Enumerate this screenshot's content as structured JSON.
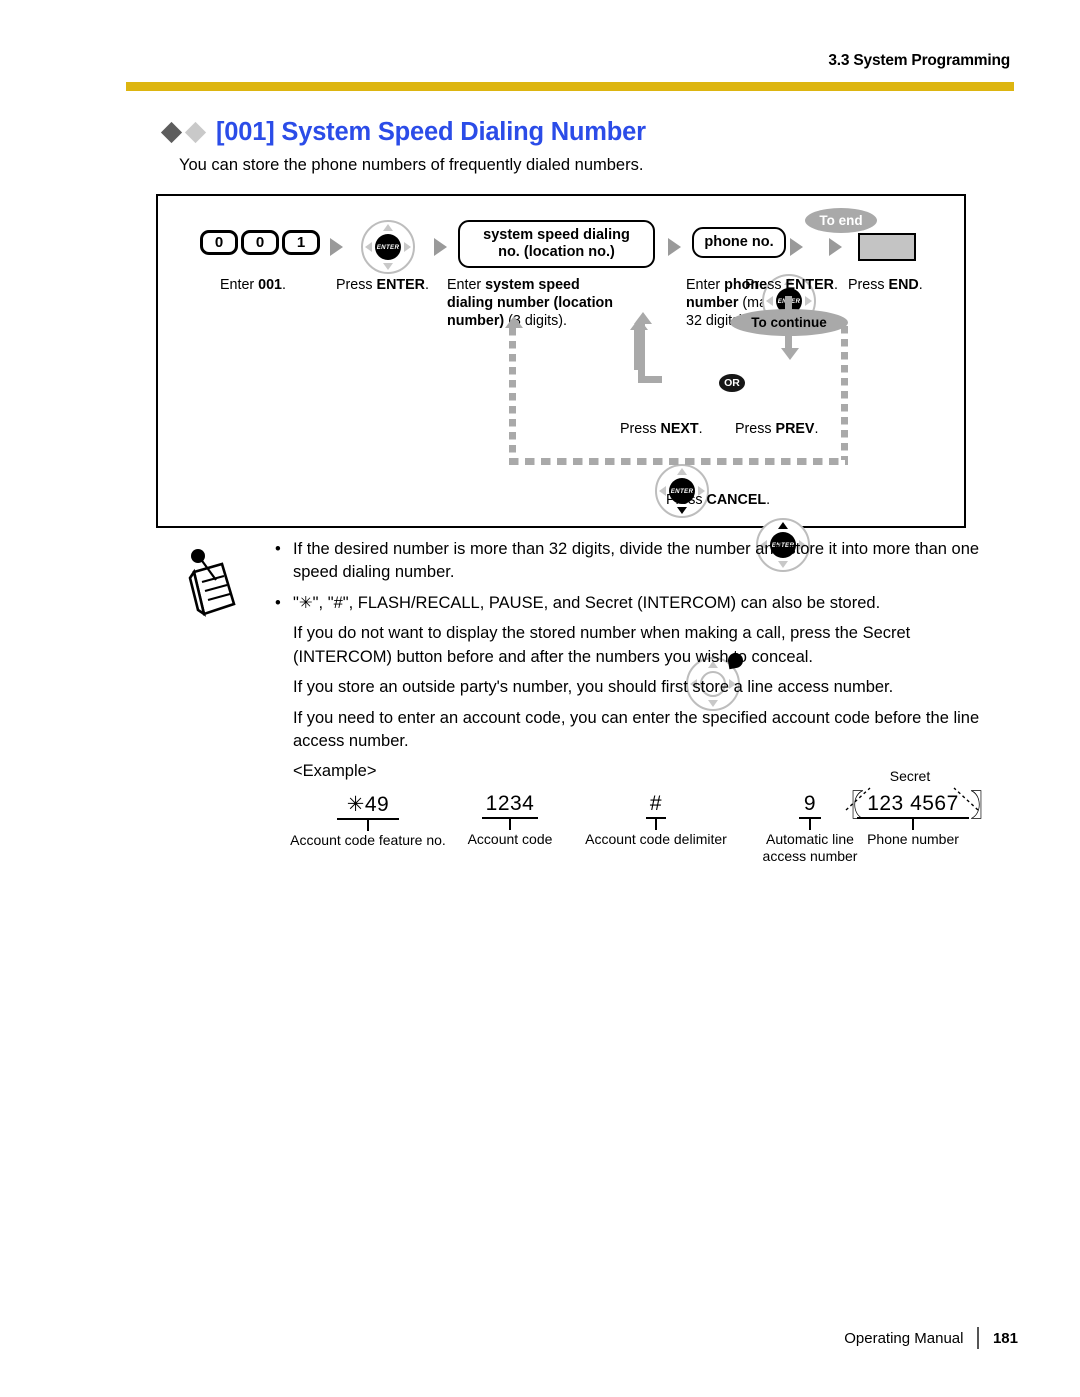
{
  "header": {
    "running_head": "3.3 System Programming",
    "rule_color": "#DDB510"
  },
  "section": {
    "title": "[001] System Speed Dialing Number",
    "title_color": "#2b4ce8",
    "intro": "You can store the phone numbers of frequently dialed numbers."
  },
  "procedure": {
    "keys": [
      "0",
      "0",
      "1"
    ],
    "pill_location": "system speed dialing\nno. (location no.)",
    "pill_location_line1": "system speed dialing",
    "pill_location_line2": "no. (location no.)",
    "pill_phone": "phone no.",
    "enter_hub_label": "ENTER",
    "to_end": "To end",
    "to_continue": "To continue",
    "or_label": "OR",
    "captions": {
      "enter001_prefix": "Enter ",
      "enter001_bold": "001",
      "enter001_suffix": ".",
      "press_enter_prefix": "Press ",
      "press_enter_bold": "ENTER",
      "press_enter_suffix": ".",
      "location_prefix": "Enter ",
      "location_bold": "system speed dialing number (location number)",
      "location_suffix": " (3 digits).",
      "phone_prefix": "Enter ",
      "phone_bold": "phone number",
      "phone_suffix": " (max. 32 digits).",
      "press_enter2_prefix": "Press ",
      "press_enter2_bold": "ENTER",
      "press_enter2_suffix": ".",
      "press_end_prefix": "Press ",
      "press_end_bold": "END",
      "press_end_suffix": ".",
      "press_next_prefix": "Press ",
      "press_next_bold": "NEXT",
      "press_next_suffix": ".",
      "press_prev_prefix": "Press ",
      "press_prev_bold": "PREV",
      "press_prev_suffix": ".",
      "press_cancel_prefix": "Press ",
      "press_cancel_bold": "CANCEL",
      "press_cancel_suffix": "."
    }
  },
  "notes": {
    "bullet_glyph": "•",
    "items": [
      "If the desired number is more than 32 digits, divide the number and store it into more than one speed dialing number.",
      "\"✳\", \"#\", FLASH/RECALL, PAUSE, and Secret (INTERCOM) can also be stored."
    ],
    "paragraphs": [
      "If you do not want to display the stored number when making a call, press the Secret (INTERCOM) button before and after the numbers you wish to conceal.",
      "If you store an outside party's number, you should first store a line access number.",
      "If you need to enter an account code, you can enter the specified account code before the line access number.",
      "<Example>"
    ]
  },
  "example": {
    "secret_label": "Secret",
    "items": [
      {
        "value": "✳49",
        "label": "Account code feature no."
      },
      {
        "value": "1234",
        "label": "Account code"
      },
      {
        "value": "#",
        "label": "Account code delimiter"
      },
      {
        "value": "9",
        "label": "Automatic line\naccess number",
        "label_line1": "Automatic line",
        "label_line2": "access number"
      },
      {
        "value": "123  4567",
        "label": "Phone number"
      }
    ]
  },
  "footer": {
    "manual": "Operating Manual",
    "page": "181"
  }
}
